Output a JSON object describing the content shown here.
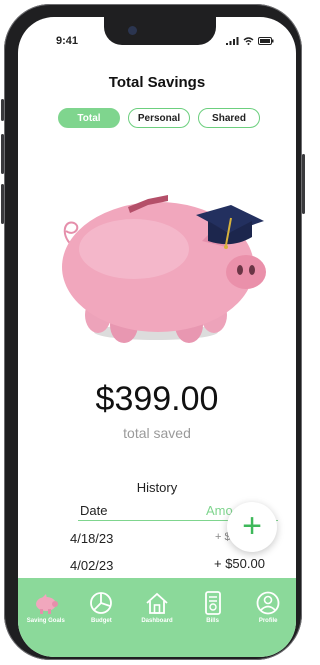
{
  "status_bar": {
    "time": "9:41"
  },
  "page": {
    "title": "Total Savings"
  },
  "tabs": [
    {
      "label": "Total",
      "active": true
    },
    {
      "label": "Personal",
      "active": false
    },
    {
      "label": "Shared",
      "active": false
    }
  ],
  "savings": {
    "amount": "$399.00",
    "caption": "total saved"
  },
  "history": {
    "title": "History",
    "columns": {
      "date": "Date",
      "amount": "Amo"
    },
    "rows": [
      {
        "date": "4/18/23",
        "amount": "+ $"
      },
      {
        "date": "4/02/23",
        "amount": "+ $50.00"
      }
    ]
  },
  "fab": {
    "label": "+"
  },
  "nav": [
    {
      "label": "Saving Goals",
      "icon": "piggy-bank-icon"
    },
    {
      "label": "Budget",
      "icon": "pie-chart-icon"
    },
    {
      "label": "Dashboard",
      "icon": "home-icon"
    },
    {
      "label": "Bills",
      "icon": "bill-icon"
    },
    {
      "label": "Profile",
      "icon": "profile-icon"
    }
  ],
  "colors": {
    "accent": "#7fd58e",
    "navbar": "#8bd99a",
    "pig": "#f1a7bd"
  }
}
